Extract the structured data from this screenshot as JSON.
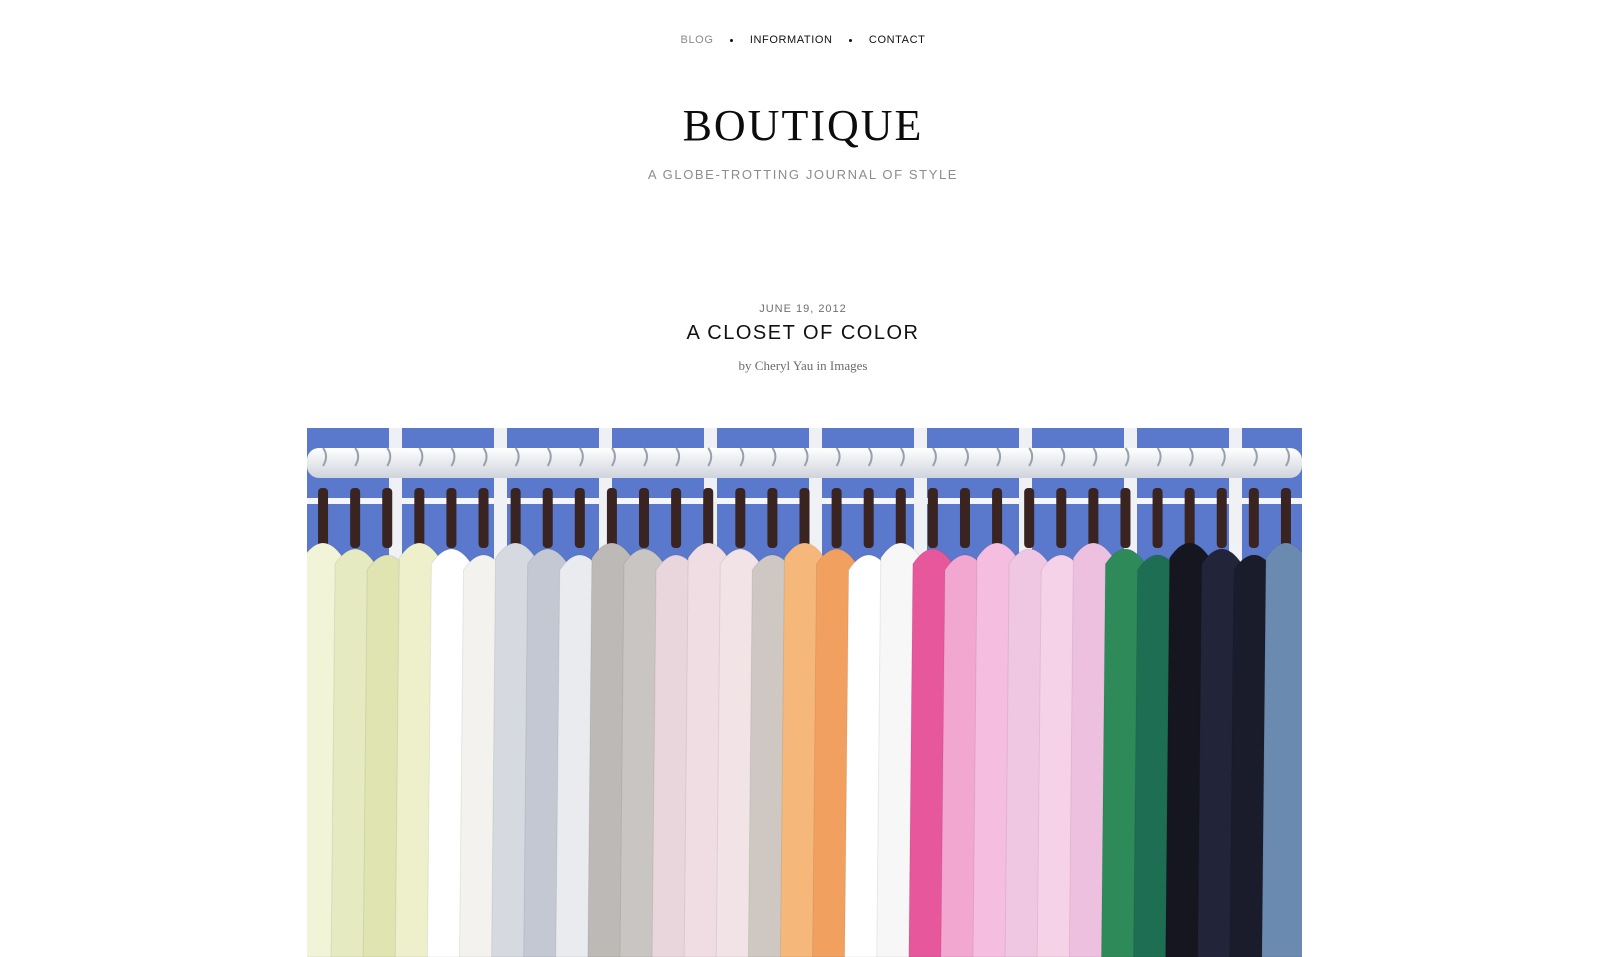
{
  "nav": {
    "items": [
      {
        "label": "BLOG",
        "active": true
      },
      {
        "label": "INFORMATION",
        "active": false
      },
      {
        "label": "CONTACT",
        "active": false
      }
    ]
  },
  "header": {
    "title": "BOUTIQUE",
    "tagline": "A GLOBE-TROTTING JOURNAL OF STYLE"
  },
  "post": {
    "date": "JUNE 19, 2012",
    "title": "A CLOSET OF COLOR",
    "by": "by",
    "author": "Cheryl Yau",
    "in": "in",
    "category": "Images"
  },
  "image": {
    "subject": "clothes rack photo",
    "colors": {
      "window_blue": "#3f63c4",
      "rail": "#e6e8ee",
      "hanger": "#3a2422",
      "garments": [
        "#e8ecc0",
        "#f7f3ee",
        "#c7ccd6",
        "#b9b6b4",
        "#e9d4da",
        "#f3a96a",
        "#ffffff",
        "#e35ba0",
        "#f3b8dc",
        "#ecc3df",
        "#2f8a5a",
        "#15161f",
        "#6a8ab0"
      ]
    }
  }
}
